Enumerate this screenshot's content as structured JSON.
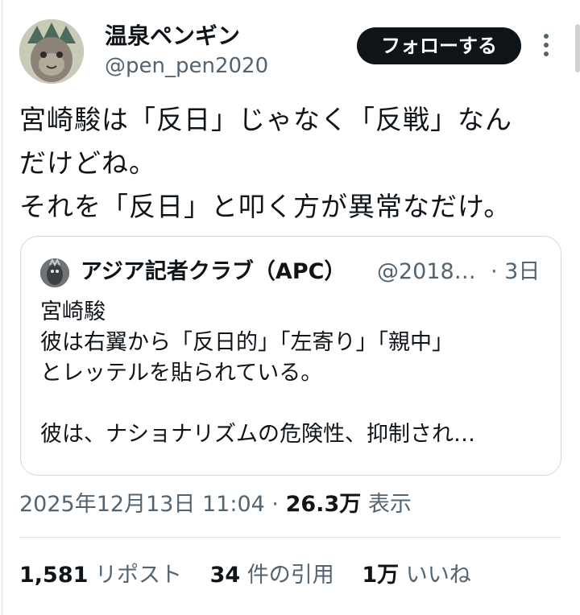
{
  "author": {
    "display_name": "温泉ペンギン",
    "handle": "@pen_pen2020"
  },
  "follow_button": {
    "label": "フォローする"
  },
  "more_icon": "more-vertical-icon",
  "tweet": {
    "lines": [
      "宮崎駿は「反日」じゃなく「反戦」なん",
      "だけどね。",
      "それを「反日」と叩く方が異常なだけ。"
    ]
  },
  "quote": {
    "name": "アジア記者クラブ（APC）",
    "handle": "@2018…",
    "time": "· 3日",
    "lines": [
      "宮崎駿",
      "彼は右翼から「反日的」「左寄り」「親中」",
      "とレッテルを貼られている。",
      "",
      "彼は、ナショナリズムの危険性、抑制され…"
    ]
  },
  "meta": {
    "datetime": "2025年12月13日 11:04",
    "separator": "·",
    "views_count": "26.3万",
    "views_label": "表示"
  },
  "stats": {
    "reposts_count": "1,581",
    "reposts_label": "リポスト",
    "quotes_count": "34",
    "quotes_label": "件の引用",
    "likes_count": "1万",
    "likes_label": "いいね"
  },
  "colors": {
    "text": "#0f1419",
    "secondary": "#536471",
    "border": "#cfd9de",
    "button_bg": "#0f1419"
  }
}
